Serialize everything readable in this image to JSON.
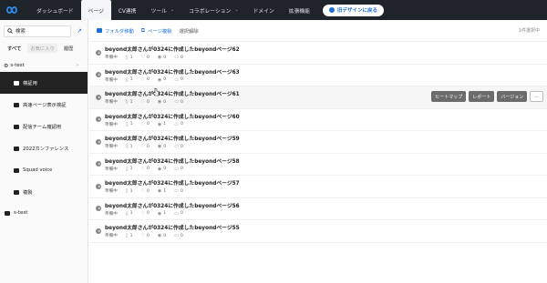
{
  "nav": {
    "items": [
      {
        "label": "ダッシュボード",
        "caret": false,
        "active": false
      },
      {
        "label": "ページ",
        "caret": false,
        "active": true
      },
      {
        "label": "CV連携",
        "caret": false,
        "active": false
      },
      {
        "label": "ツール",
        "caret": true,
        "active": false
      },
      {
        "label": "コラボレーション",
        "caret": true,
        "active": false
      },
      {
        "label": "ドメイン",
        "caret": false,
        "active": false
      },
      {
        "label": "拡張機能",
        "caret": false,
        "active": false
      }
    ],
    "new_design_label": "旧デザインに戻る",
    "accent": "#1a6fd8"
  },
  "sidebar": {
    "search_label": "検索",
    "filter_tabs": [
      "すべて",
      "お気に入り",
      "履歴"
    ],
    "root_label": "s-test",
    "folders": [
      "検証用",
      "高速ページ表示検証",
      "配信チーム確認用",
      "2022カンファレンス",
      "Squad voice",
      "複製"
    ],
    "bottom_label": "s-test"
  },
  "toolbar": {
    "move_folder": "フォルダ移動",
    "duplicate": "ページ複製",
    "deselect": "選択解除",
    "count": "1件選択中"
  },
  "pages": [
    {
      "title": "beyond太郎さんが0324に作成したbeyondページ62",
      "status": "準備中",
      "pv": "1",
      "cv": "0",
      "views": "0",
      "comments": "0"
    },
    {
      "title": "beyond太郎さんが0324に作成したbeyondページ63",
      "status": "準備中",
      "pv": "1",
      "cv": "0",
      "views": "0",
      "comments": "0"
    },
    {
      "title": "beyond太郎さんが0324に作成したbeyondページ61",
      "status": "準備中",
      "pv": "1",
      "cv": "0",
      "views": "0",
      "comments": "0"
    },
    {
      "title": "beyond太郎さんが0324に作成したbeyondページ60",
      "status": "準備中",
      "pv": "1",
      "cv": "0",
      "views": "1",
      "comments": "0"
    },
    {
      "title": "beyond太郎さんが0324に作成したbeyondページ59",
      "status": "準備中",
      "pv": "1",
      "cv": "0",
      "views": "0",
      "comments": "0"
    },
    {
      "title": "beyond太郎さんが0324に作成したbeyondページ58",
      "status": "準備中",
      "pv": "1",
      "cv": "0",
      "views": "0",
      "comments": "0"
    },
    {
      "title": "beyond太郎さんが0324に作成したbeyondページ57",
      "status": "準備中",
      "pv": "1",
      "cv": "0",
      "views": "1",
      "comments": "0"
    },
    {
      "title": "beyond太郎さんが0324に作成したbeyondページ56",
      "status": "準備中",
      "pv": "1",
      "cv": "0",
      "views": "1",
      "comments": "0"
    },
    {
      "title": "beyond太郎さんが0324に作成したbeyondページ55",
      "status": "準備中",
      "pv": "1",
      "cv": "0",
      "views": "0",
      "comments": "0"
    }
  ],
  "row_actions": {
    "heatmap": "ヒートマップ",
    "report": "レポート",
    "version": "バージョン",
    "more": "..."
  },
  "icons": {
    "logo": "loop-logo-icon",
    "move": "folder-icon",
    "duplicate": "copy-icon",
    "search": "search-icon"
  }
}
